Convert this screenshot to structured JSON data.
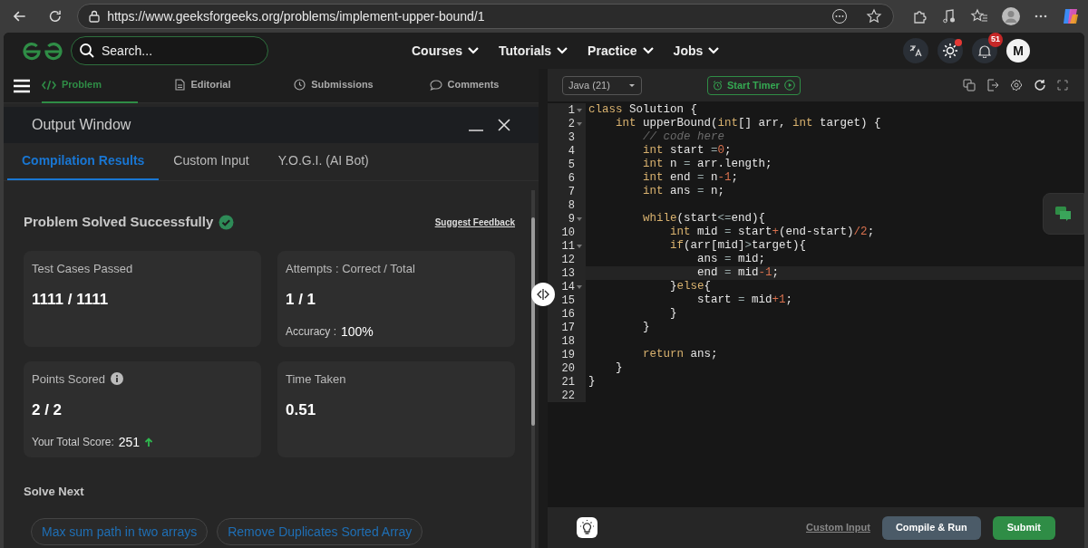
{
  "browser": {
    "url": "https://www.geeksforgeeks.org/problems/implement-upper-bound/1"
  },
  "header": {
    "search_placeholder": "Search...",
    "nav": [
      "Courses",
      "Tutorials",
      "Practice",
      "Jobs"
    ],
    "notification_count": "51",
    "notification_dot": true,
    "avatar": "M"
  },
  "problem_tabs": [
    {
      "label": "Problem",
      "selected": true
    },
    {
      "label": "Editorial",
      "selected": false
    },
    {
      "label": "Submissions",
      "selected": false
    },
    {
      "label": "Comments",
      "selected": false
    }
  ],
  "output_window": {
    "title": "Output Window",
    "tabs": [
      {
        "label": "Compilation Results",
        "selected": true
      },
      {
        "label": "Custom Input",
        "selected": false
      },
      {
        "label": "Y.O.G.I. (AI Bot)",
        "selected": false
      }
    ],
    "status": "Problem Solved Successfully",
    "feedback_link": "Suggest Feedback",
    "cards": [
      {
        "label": "Test Cases Passed",
        "info": false,
        "value": "1111 / 1111"
      },
      {
        "label": "Attempts : Correct / Total",
        "info": false,
        "value": "1 / 1",
        "note": {
          "label": "Accuracy :",
          "value": "100%",
          "trending_up": false
        }
      },
      {
        "label": "Points Scored",
        "info": true,
        "value": "2 / 2",
        "note": {
          "label": "Your Total Score:",
          "value": "251",
          "trending_up": true
        }
      },
      {
        "label": "Time Taken",
        "info": false,
        "value": "0.51"
      }
    ],
    "solve_next_title": "Solve Next",
    "solve_next": [
      "Max sum path in two arrays",
      "Remove Duplicates Sorted Array"
    ]
  },
  "editor": {
    "language": "Java (21)",
    "timer_button": "Start Timer",
    "lines": [
      {
        "n": "1",
        "fold": true,
        "active": false,
        "tokens": [
          {
            "kind": "keyword",
            "text": "class"
          },
          {
            "kind": "plain",
            "text": " Solution {"
          }
        ]
      },
      {
        "n": "2",
        "fold": true,
        "active": false,
        "tokens": [
          {
            "kind": "keyword",
            "text": "    int"
          },
          {
            "kind": "plain",
            "text": " upperBound("
          },
          {
            "kind": "keyword",
            "text": "int"
          },
          {
            "kind": "plain",
            "text": "[] arr, "
          },
          {
            "kind": "keyword",
            "text": "int"
          },
          {
            "kind": "plain",
            "text": " target) {"
          }
        ]
      },
      {
        "n": "3",
        "fold": false,
        "active": false,
        "tokens": [
          {
            "kind": "comment",
            "text": "        // code here"
          }
        ]
      },
      {
        "n": "4",
        "fold": false,
        "active": false,
        "tokens": [
          {
            "kind": "keyword",
            "text": "        int"
          },
          {
            "kind": "plain",
            "text": " start "
          },
          {
            "kind": "operator",
            "text": "="
          },
          {
            "kind": "number",
            "text": "0"
          },
          {
            "kind": "plain",
            "text": ";"
          }
        ]
      },
      {
        "n": "5",
        "fold": false,
        "active": false,
        "tokens": [
          {
            "kind": "keyword",
            "text": "        int"
          },
          {
            "kind": "plain",
            "text": " n "
          },
          {
            "kind": "operator",
            "text": "="
          },
          {
            "kind": "plain",
            "text": " arr.length;"
          }
        ]
      },
      {
        "n": "6",
        "fold": false,
        "active": false,
        "tokens": [
          {
            "kind": "keyword",
            "text": "        int"
          },
          {
            "kind": "plain",
            "text": " end "
          },
          {
            "kind": "operator",
            "text": "="
          },
          {
            "kind": "plain",
            "text": " n"
          },
          {
            "kind": "number",
            "text": "-1"
          },
          {
            "kind": "plain",
            "text": ";"
          }
        ]
      },
      {
        "n": "7",
        "fold": false,
        "active": false,
        "tokens": [
          {
            "kind": "keyword",
            "text": "        int"
          },
          {
            "kind": "plain",
            "text": " ans "
          },
          {
            "kind": "operator",
            "text": "="
          },
          {
            "kind": "plain",
            "text": " n;"
          }
        ]
      },
      {
        "n": "8",
        "fold": false,
        "active": false
      },
      {
        "n": "9",
        "fold": true,
        "active": false,
        "tokens": [
          {
            "kind": "keyword",
            "text": "        while"
          },
          {
            "kind": "plain",
            "text": "(start"
          },
          {
            "kind": "operator",
            "text": "<="
          },
          {
            "kind": "plain",
            "text": "end){"
          }
        ]
      },
      {
        "n": "10",
        "fold": false,
        "active": false,
        "tokens": [
          {
            "kind": "keyword",
            "text": "            int"
          },
          {
            "kind": "plain",
            "text": " mid "
          },
          {
            "kind": "operator",
            "text": "="
          },
          {
            "kind": "plain",
            "text": " start"
          },
          {
            "kind": "number",
            "text": "+"
          },
          {
            "kind": "plain",
            "text": "(end-start)"
          },
          {
            "kind": "number",
            "text": "/2"
          },
          {
            "kind": "plain",
            "text": ";"
          }
        ]
      },
      {
        "n": "11",
        "fold": true,
        "active": false,
        "tokens": [
          {
            "kind": "keyword",
            "text": "            if"
          },
          {
            "kind": "plain",
            "text": "(arr[mid]"
          },
          {
            "kind": "operator",
            "text": ">"
          },
          {
            "kind": "plain",
            "text": "target){"
          }
        ]
      },
      {
        "n": "12",
        "fold": false,
        "active": false,
        "tokens": [
          {
            "kind": "plain",
            "text": "                ans "
          },
          {
            "kind": "operator",
            "text": "="
          },
          {
            "kind": "plain",
            "text": " mid;"
          }
        ]
      },
      {
        "n": "13",
        "fold": false,
        "active": true,
        "tokens": [
          {
            "kind": "plain",
            "text": "                end "
          },
          {
            "kind": "operator",
            "text": "="
          },
          {
            "kind": "plain",
            "text": " mid"
          },
          {
            "kind": "number",
            "text": "-1"
          },
          {
            "kind": "plain",
            "text": ";"
          }
        ]
      },
      {
        "n": "14",
        "fold": true,
        "active": false,
        "tokens": [
          {
            "kind": "plain",
            "text": "            }"
          },
          {
            "kind": "keyword",
            "text": "else"
          },
          {
            "kind": "plain",
            "text": "{"
          }
        ]
      },
      {
        "n": "15",
        "fold": false,
        "active": false,
        "tokens": [
          {
            "kind": "plain",
            "text": "                start "
          },
          {
            "kind": "operator",
            "text": "="
          },
          {
            "kind": "plain",
            "text": " mid"
          },
          {
            "kind": "number",
            "text": "+1"
          },
          {
            "kind": "plain",
            "text": ";"
          }
        ]
      },
      {
        "n": "16",
        "fold": false,
        "active": false,
        "tokens": [
          {
            "kind": "plain",
            "text": "            }"
          }
        ]
      },
      {
        "n": "17",
        "fold": false,
        "active": false,
        "tokens": [
          {
            "kind": "plain",
            "text": "        }"
          }
        ]
      },
      {
        "n": "18",
        "fold": false,
        "active": false
      },
      {
        "n": "19",
        "fold": false,
        "active": false,
        "tokens": [
          {
            "kind": "keyword",
            "text": "        return"
          },
          {
            "kind": "plain",
            "text": " ans;"
          }
        ]
      },
      {
        "n": "20",
        "fold": false,
        "active": false,
        "tokens": [
          {
            "kind": "plain",
            "text": "    }"
          }
        ]
      },
      {
        "n": "21",
        "fold": false,
        "active": false,
        "tokens": [
          {
            "kind": "plain",
            "text": "}"
          }
        ]
      },
      {
        "n": "22",
        "fold": false,
        "active": false
      }
    ],
    "custom_input_link": "Custom Input",
    "compile_button": "Compile & Run",
    "submit_button": "Submit"
  }
}
